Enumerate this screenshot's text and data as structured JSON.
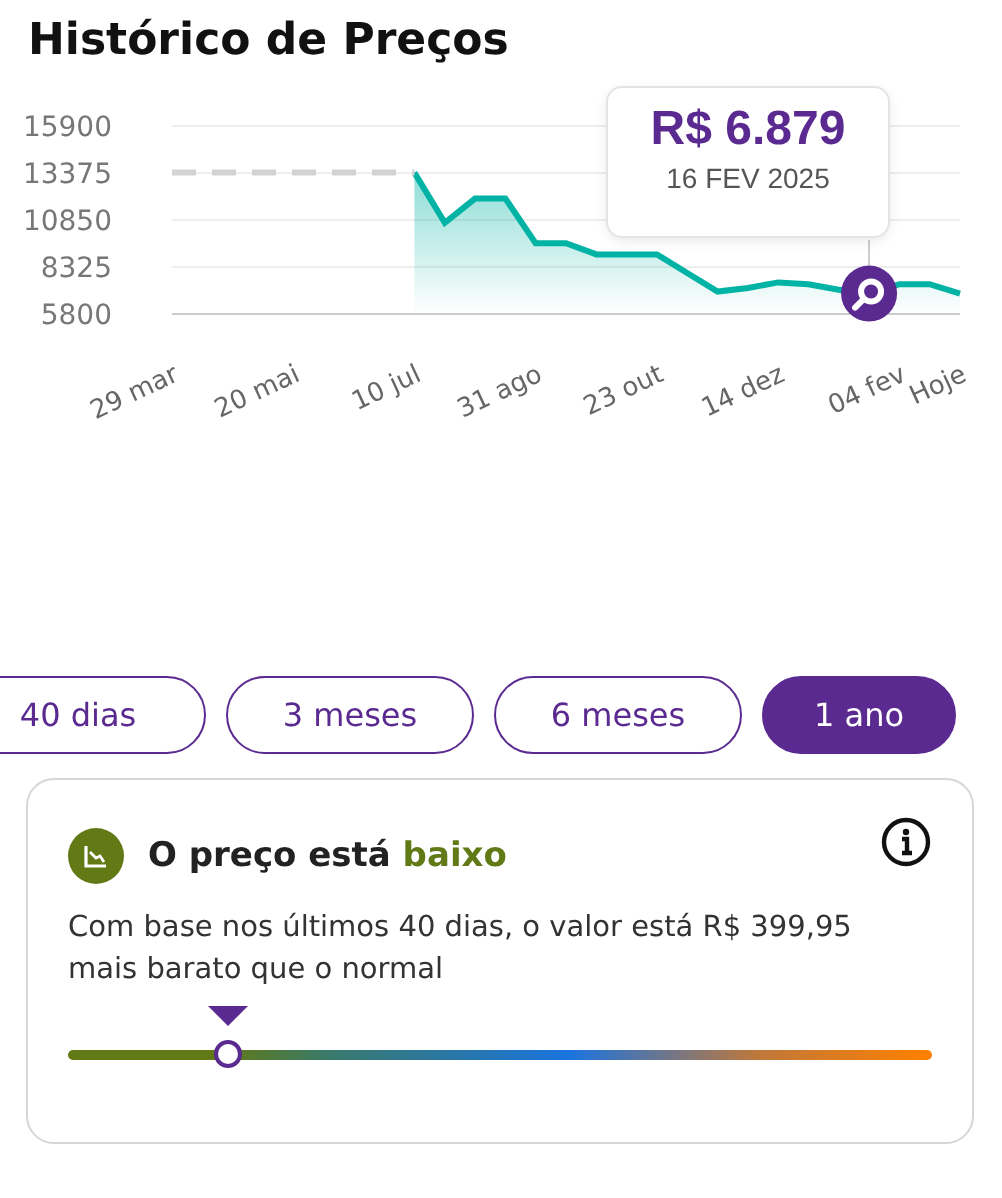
{
  "title": "Histórico de Preços",
  "chart": {
    "chart_data": {
      "type": "area",
      "grid": true,
      "categories": [
        "29 mar",
        null,
        null,
        null,
        "20 mai",
        null,
        null,
        null,
        "10 jul",
        null,
        null,
        null,
        "31 ago",
        null,
        null,
        null,
        "23 out",
        null,
        null,
        null,
        "14 dez",
        null,
        null,
        null,
        "04 fev",
        null,
        "Hoje"
      ],
      "ylim": [
        5800,
        15900
      ],
      "yticks": [
        5800,
        8325,
        10850,
        13375,
        15900
      ],
      "series": [
        {
          "color": "#00b3a4",
          "type": "area",
          "line_style": "solid",
          "values": [
            null,
            null,
            null,
            null,
            null,
            null,
            null,
            null,
            13400,
            10700,
            12000,
            12000,
            9600,
            9600,
            9000,
            9000,
            9000,
            8000,
            7000,
            7200,
            7500,
            7400,
            7100,
            6900,
            7400,
            7400,
            6900
          ]
        },
        {
          "color": "#d3d3d3",
          "type": "line",
          "line_style": "dashed",
          "values": [
            13400,
            13400,
            13400,
            13400,
            13400,
            13400,
            13400,
            13400,
            13400,
            null,
            null,
            null,
            null,
            null,
            null,
            null,
            null,
            null,
            null,
            null,
            null,
            null,
            null,
            null,
            null,
            null,
            null
          ]
        }
      ]
    },
    "tooltip": {
      "price": "R$ 6.879",
      "date": "16 FEV 2025"
    }
  },
  "ranges": [
    {
      "label": "40 dias",
      "selected": false
    },
    {
      "label": "3 meses",
      "selected": false
    },
    {
      "label": "6 meses",
      "selected": false
    },
    {
      "label": "1 ano",
      "selected": true
    }
  ],
  "status": {
    "title": "O preço está",
    "level_word": "baixo",
    "color": "#617a16",
    "description": "Com base nos últimos 40 dias, o valor está R$ 399,95 mais barato que o normal"
  }
}
